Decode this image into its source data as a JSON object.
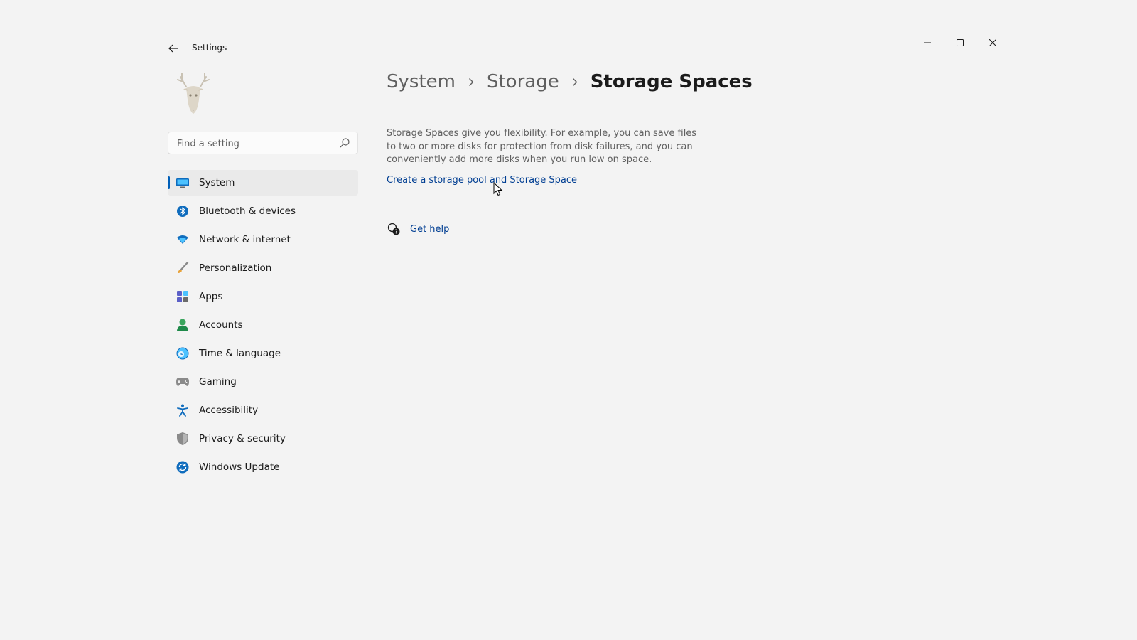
{
  "titlebar": {
    "title": "Settings",
    "back_icon": "arrow-left-icon",
    "controls": [
      "minimize-icon",
      "maximize-icon",
      "close-icon"
    ]
  },
  "search": {
    "placeholder": "Find a setting",
    "value": "",
    "icon": "search-icon"
  },
  "sidebar": {
    "items": [
      {
        "label": "System",
        "icon": "system-display-icon",
        "active": true
      },
      {
        "label": "Bluetooth & devices",
        "icon": "bluetooth-icon"
      },
      {
        "label": "Network & internet",
        "icon": "wifi-icon"
      },
      {
        "label": "Personalization",
        "icon": "brush-icon"
      },
      {
        "label": "Apps",
        "icon": "apps-icon"
      },
      {
        "label": "Accounts",
        "icon": "person-icon"
      },
      {
        "label": "Time & language",
        "icon": "globe-clock-icon"
      },
      {
        "label": "Gaming",
        "icon": "gamepad-icon"
      },
      {
        "label": "Accessibility",
        "icon": "accessibility-icon"
      },
      {
        "label": "Privacy & security",
        "icon": "shield-icon"
      },
      {
        "label": "Windows Update",
        "icon": "update-icon"
      }
    ]
  },
  "main": {
    "breadcrumb": [
      "System",
      "Storage",
      "Storage Spaces"
    ],
    "description": "Storage Spaces give you flexibility. For example, you can save files to two or more disks for protection from disk failures, and you can conveniently add more disks when you run low on space.",
    "create_link": "Create a storage pool and Storage Space",
    "help_link": "Get help"
  },
  "colors": {
    "accent": "#005fb8",
    "link": "#003e92",
    "background": "#f3f3f3"
  }
}
